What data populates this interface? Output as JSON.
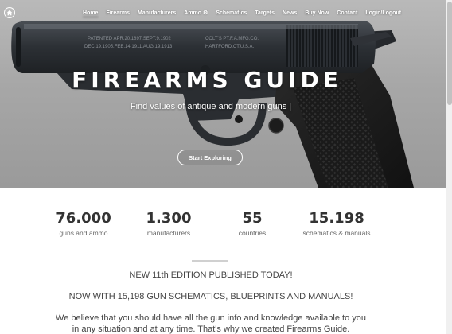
{
  "nav": {
    "items": [
      {
        "label": "Home",
        "active": true
      },
      {
        "label": "Firearms"
      },
      {
        "label": "Manufacturers"
      },
      {
        "label": "Ammo"
      },
      {
        "label": "Schematics"
      },
      {
        "label": "Targets"
      },
      {
        "label": "News"
      },
      {
        "label": "Buy Now"
      },
      {
        "label": "Contact"
      },
      {
        "label": "Login/Logout"
      }
    ],
    "ammo_icon": "gear-icon"
  },
  "hero": {
    "title": "FIREARMS GUIDE",
    "subtitle": "Find values of antique and modern guns |",
    "button": "Start Exploring",
    "engraving": {
      "left_line1": "PATENTED APR.20.1897.SEPT.9.1902",
      "left_line2": "DEC.19.1905.FEB.14.1911.AUG.19.1913",
      "right_line1": "COLT'S PT.F.A.MFG.CO.",
      "right_line2": "HARTFORD.CT.U.S.A."
    }
  },
  "stats": [
    {
      "value": "76.000",
      "label": "guns and ammo"
    },
    {
      "value": "1.300",
      "label": "manufacturers"
    },
    {
      "value": "55",
      "label": "countries"
    },
    {
      "value": "15.198",
      "label": "schematics & manuals"
    }
  ],
  "content": {
    "edition": "NEW 11th EDITION PUBLISHED TODAY!",
    "schematics": "NOW WITH 15,198 GUN SCHEMATICS, BLUEPRINTS AND MANUALS!",
    "para_line1": "We believe that you should have all the gun info and knowledge available to you",
    "para_line2": "in any situation and at any time. That's why we created Firearms Guide."
  },
  "colors": {
    "hero_bg": "#a8a8a8",
    "text_dark": "#333333",
    "text_muted": "#666666"
  }
}
